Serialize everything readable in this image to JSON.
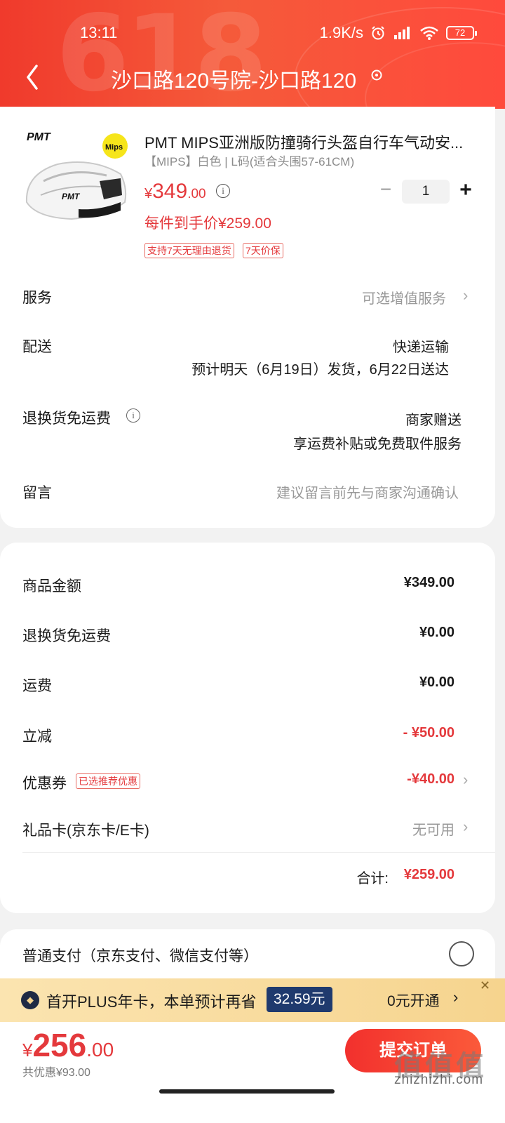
{
  "status_bar": {
    "time": "13:11",
    "network_speed": "1.9K/s",
    "battery": "72"
  },
  "header": {
    "title": "沙口路120号院-沙口路120",
    "decor_text": "618"
  },
  "product": {
    "brand_label": "PMT",
    "badge": "Mips",
    "title": "PMT MIPS亚洲版防撞骑行头盔自行车气动安...",
    "spec": "【MIPS】白色 | L码(适合头围57-61CM)",
    "price_yen": "¥",
    "price_int": "349",
    "price_dec": ".00",
    "each_price": "每件到手价¥259.00",
    "tags": [
      "支持7天无理由退货",
      "7天价保"
    ],
    "quantity": "1"
  },
  "rows": {
    "service_label": "服务",
    "service_value": "可选增值服务",
    "delivery_label": "配送",
    "delivery_value": "快递运输",
    "delivery_sub": "预计明天（6月19日）发货，6月22日送达",
    "return_label": "退换货免运费",
    "return_value": "商家赠送",
    "return_sub": "享运费补贴或免费取件服务",
    "message_label": "留言",
    "message_placeholder": "建议留言前先与商家沟通确认"
  },
  "summary": {
    "goods_label": "商品金额",
    "goods_value": "¥349.00",
    "return_fee_label": "退换货免运费",
    "return_fee_value": "¥0.00",
    "shipping_label": "运费",
    "shipping_value": "¥0.00",
    "discount_label": "立减",
    "discount_value": "- ¥50.00",
    "coupon_label": "优惠券",
    "coupon_tag": "已选推荐优惠",
    "coupon_value": "-¥40.00",
    "giftcard_label": "礼品卡(京东卡/E卡)",
    "giftcard_value": "无可用",
    "total_label": "合计:",
    "total_value": "¥259.00"
  },
  "payment": {
    "normal_label": "普通支付（京东支付、微信支付等）"
  },
  "plus_banner": {
    "text": "首开PLUS年卡，本单预计再省",
    "amount": "32.59元",
    "open_label": "0元开通"
  },
  "bottom": {
    "yen": "¥",
    "total_int": "256",
    "total_dec": ".00",
    "discount_total": "共优惠¥93.00",
    "submit_label": "提交订单",
    "watermark": "zhizhizhi.com"
  }
}
